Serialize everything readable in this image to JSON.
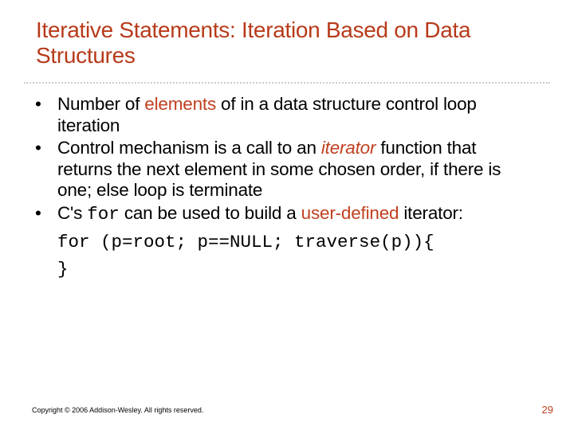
{
  "title": "Iterative Statements: Iteration Based on Data Structures",
  "bullets": {
    "b1_pre": "Number of ",
    "b1_accent": "elements",
    "b1_post": " of in a data structure control loop iteration",
    "b2_pre": "Control mechanism is a call to an ",
    "b2_accent": "iterator",
    "b2_post": " function that returns the next element in some chosen order, if there is one; else loop is terminate",
    "b3_pre": "C's ",
    "b3_mono": "for",
    "b3_mid": " can be used to build a ",
    "b3_accent": "user-defined",
    "b3_post": " iterator:"
  },
  "code": {
    "line1": "for (p=root; p==NULL; traverse(p)){",
    "line2": "}"
  },
  "footer": "Copyright © 2006 Addison-Wesley. All rights reserved.",
  "page": "29"
}
